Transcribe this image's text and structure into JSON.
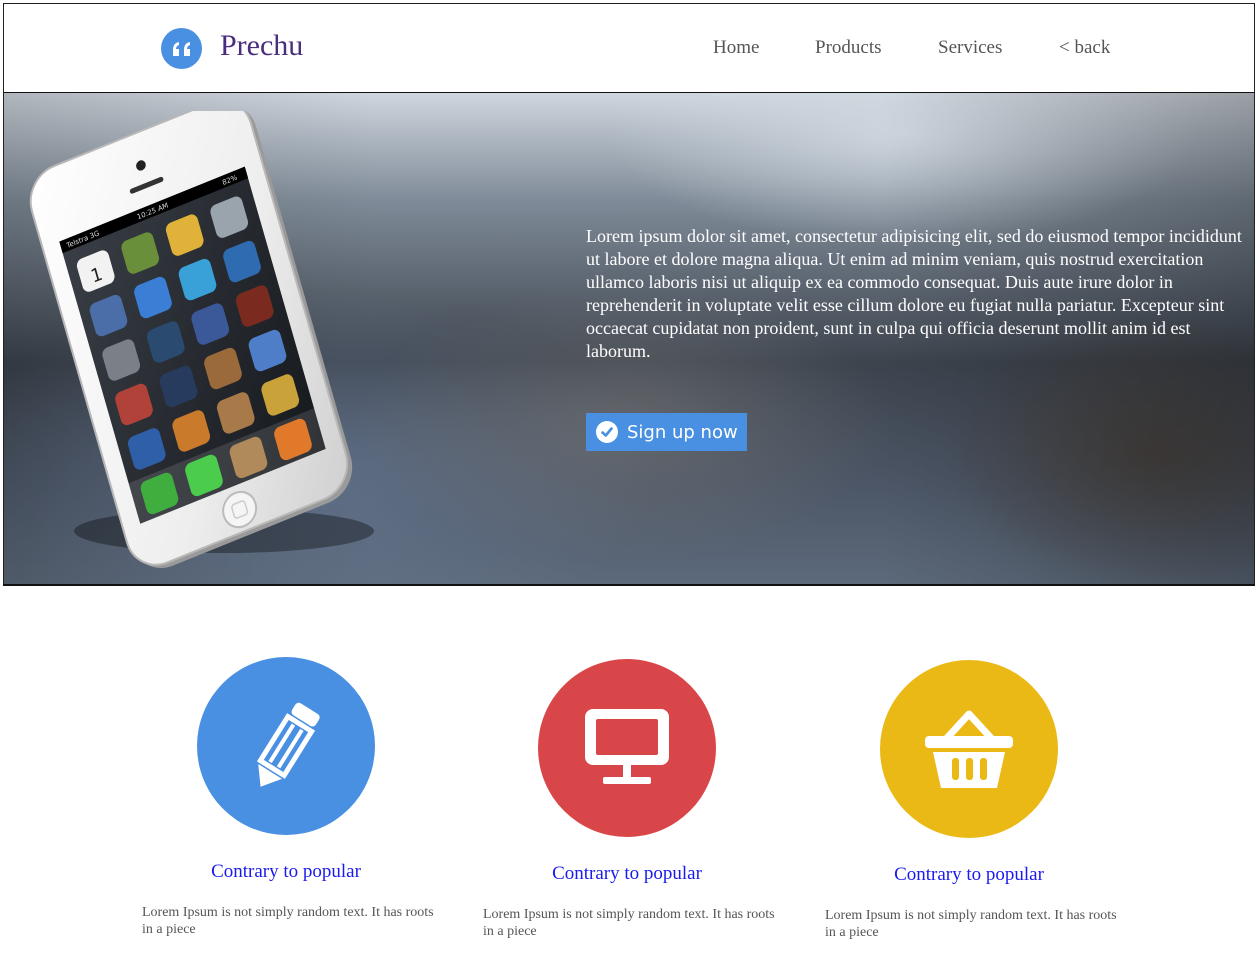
{
  "header": {
    "logo_text": "Prechu",
    "logo_icon": "quote-icon",
    "nav": [
      {
        "label": "Home"
      },
      {
        "label": "Products"
      },
      {
        "label": "Services"
      },
      {
        "label": "< back"
      }
    ]
  },
  "hero": {
    "text": "Lorem ipsum dolor sit amet, consectetur adipisicing elit, sed do eiusmod tempor incididunt ut labore et dolore magna aliqua. Ut enim ad minim veniam, quis nostrud exercitation ullamco laboris nisi ut aliquip ex ea commodo consequat. Duis aute irure dolor in reprehenderit in voluptate velit esse cillum dolore eu fugiat nulla pariatur. Excepteur sint occaecat cupidatat non proident, sunt in culpa qui officia deserunt mollit anim id est laborum.",
    "button_label": "Sign up now",
    "button_icon": "check-circle-icon",
    "image": "smartphone-image",
    "phone_time": "10:25 AM",
    "phone_carrier": "Telstra 3G",
    "phone_battery": "82%",
    "phone_date_number": "1"
  },
  "features": [
    {
      "icon": "pencil-icon",
      "color": "#4a90e2",
      "title": "Contrary to popular",
      "text": "Lorem Ipsum is not simply random text. It has roots in a piece"
    },
    {
      "icon": "monitor-icon",
      "color": "#d9464a",
      "title": "Contrary to popular",
      "text": "Lorem Ipsum is not simply random text. It has roots in a piece"
    },
    {
      "icon": "basket-icon",
      "color": "#ebb915",
      "title": "Contrary to popular",
      "text": "Lorem Ipsum is not simply random text. It has roots in a piece"
    }
  ],
  "colors": {
    "accent_blue": "#4a90e2",
    "logo_purple": "#4b2d7d",
    "link_blue": "#1a1aee"
  }
}
